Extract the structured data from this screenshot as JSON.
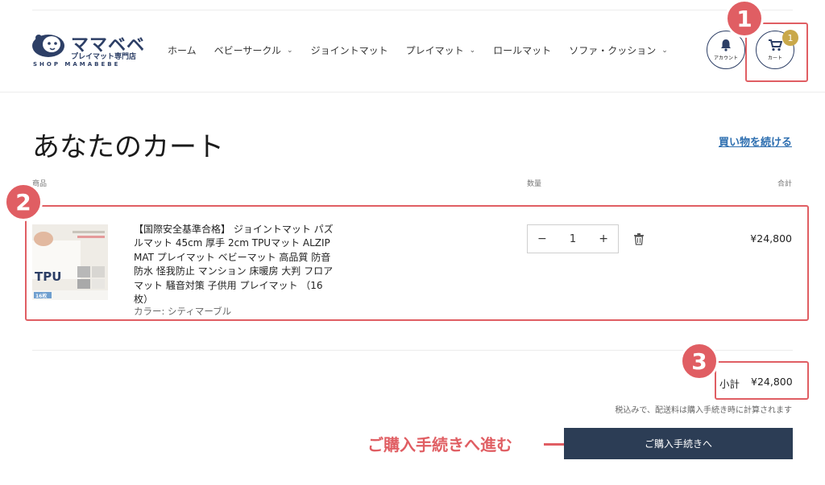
{
  "header": {
    "logo": {
      "main_text": "ママベベ",
      "sub_text": "プレイマット専門店",
      "en_text": "SHOP MAMABEBE"
    },
    "nav": [
      {
        "label": "ホーム",
        "has_dropdown": false
      },
      {
        "label": "ベビーサークル",
        "has_dropdown": true
      },
      {
        "label": "ジョイントマット",
        "has_dropdown": false
      },
      {
        "label": "プレイマット",
        "has_dropdown": true
      },
      {
        "label": "ロールマット",
        "has_dropdown": false
      },
      {
        "label": "ソファ・クッション",
        "has_dropdown": true
      }
    ],
    "account_label": "アカウント",
    "cart_label": "カート",
    "cart_count": "1"
  },
  "cart": {
    "title": "あなたのカート",
    "continue_shopping": "買い物を続ける",
    "columns": {
      "product": "商品",
      "quantity": "数量",
      "total": "合計"
    },
    "items": [
      {
        "title": "【国際安全基準合格】 ジョイントマット パズルマット 45cm 厚手 2cm TPUマット ALZIP MAT プレイマット ベビーマット 高品質 防音 防水 怪我防止 マンション 床暖房 大判 フロアマット 騒音対策 子供用 プレイマット （16枚）",
        "variant": "カラー: シティマーブル",
        "quantity": "1",
        "price": "¥24,800",
        "image_text": {
          "tpu": "TPU",
          "count": "16枚"
        }
      }
    ],
    "subtotal_label": "小計",
    "subtotal_value": "¥24,800",
    "tax_note": "税込みで、配送料は購入手続き時に計算されます",
    "checkout_label": "ご購入手続きへ"
  },
  "annotations": {
    "badge_1": "1",
    "badge_2": "2",
    "badge_3": "3",
    "checkout_callout": "ご購入手続きへ進む",
    "color": "#e05e63"
  },
  "colors": {
    "brand_navy": "#2d3f66",
    "checkout_button": "#2c3d55",
    "link_blue": "#2e6fb0",
    "cart_badge": "#c9a84a"
  }
}
